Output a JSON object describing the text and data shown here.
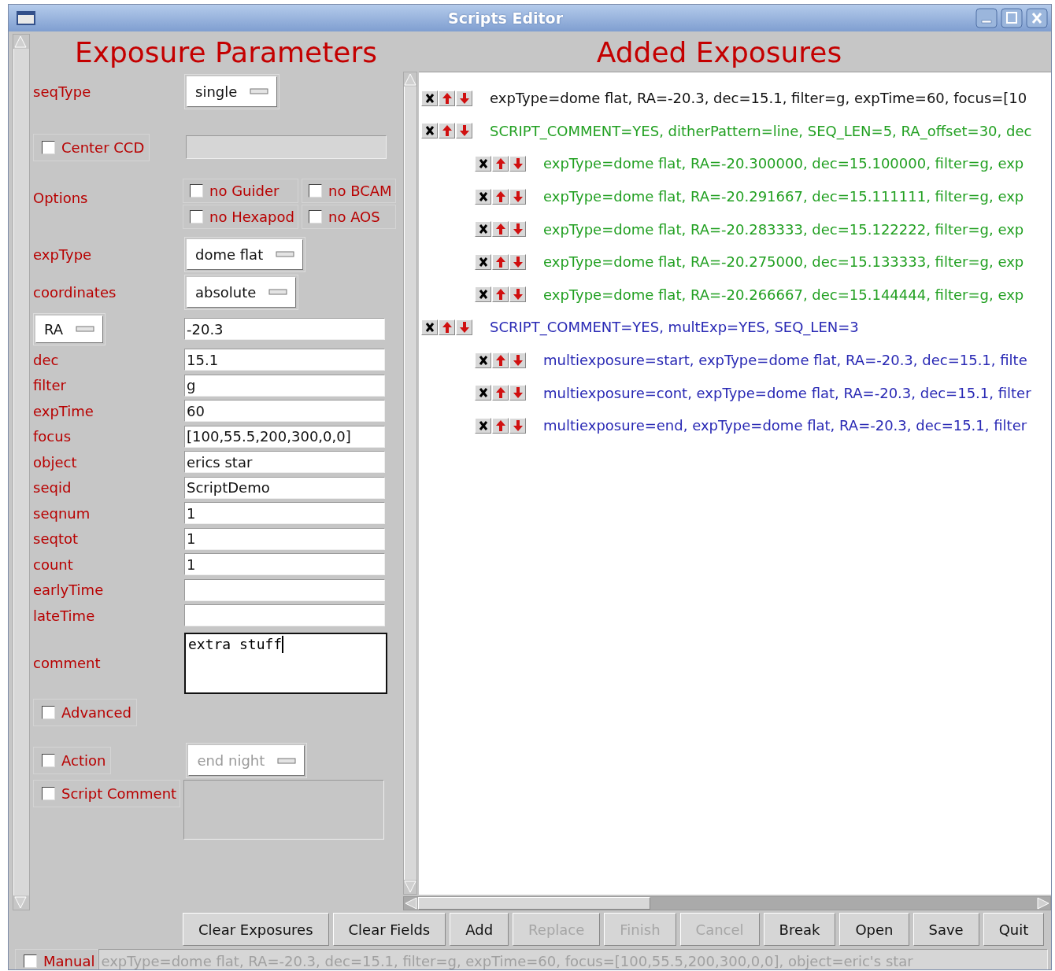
{
  "window": {
    "title": "Scripts Editor"
  },
  "parameters": {
    "title": "Exposure Parameters",
    "rows": [
      {
        "kind": "dropdown",
        "label": "seqType",
        "value": "single"
      },
      {
        "kind": "check_field",
        "label": "Center CCD",
        "checked": false
      },
      {
        "kind": "options",
        "label": "Options",
        "options": [
          {
            "label": "no Guider",
            "checked": false
          },
          {
            "label": "no BCAM",
            "checked": false
          },
          {
            "label": "no Hexapod",
            "checked": false
          },
          {
            "label": "no AOS",
            "checked": false
          }
        ]
      },
      {
        "kind": "dropdown",
        "label": "expType",
        "value": "dome flat"
      },
      {
        "kind": "dropdown",
        "label": "coordinates",
        "value": "absolute"
      },
      {
        "kind": "select_field",
        "selector": "RA",
        "value": "-20.3"
      },
      {
        "kind": "text",
        "label": "dec",
        "value": "15.1"
      },
      {
        "kind": "text",
        "label": "filter",
        "value": "g"
      },
      {
        "kind": "text",
        "label": "expTime",
        "value": "60"
      },
      {
        "kind": "text",
        "label": "focus",
        "value": "[100,55.5,200,300,0,0]"
      },
      {
        "kind": "text",
        "label": "object",
        "value": "erics star"
      },
      {
        "kind": "text",
        "label": "seqid",
        "value": "ScriptDemo"
      },
      {
        "kind": "text",
        "label": "seqnum",
        "value": "1"
      },
      {
        "kind": "text",
        "label": "seqtot",
        "value": "1"
      },
      {
        "kind": "text",
        "label": "count",
        "value": "1"
      },
      {
        "kind": "text",
        "label": "earlyTime"
      },
      {
        "kind": "text",
        "label": "lateTime"
      },
      {
        "kind": "textarea",
        "label": "comment",
        "value": "extra stuff"
      },
      {
        "kind": "check",
        "label": "Advanced",
        "checked": false
      },
      {
        "kind": "check_dropdown",
        "label": "Action",
        "checked": false,
        "value": "end night",
        "disabled": true
      },
      {
        "kind": "check_area",
        "label": "Script Comment",
        "checked": false
      }
    ]
  },
  "exposures": {
    "title": "Added Exposures",
    "items": [
      {
        "text": "expType=dome flat, RA=-20.3, dec=15.1, filter=g, expTime=60, focus=[10",
        "color": "#111111"
      },
      {
        "text": "SCRIPT_COMMENT=YES, ditherPattern=line, SEQ_LEN=5, RA_offset=30, dec",
        "color": "#22a022",
        "children": [
          {
            "text": "expType=dome flat, RA=-20.300000, dec=15.100000, filter=g, exp",
            "color": "#22a022"
          },
          {
            "text": "expType=dome flat, RA=-20.291667, dec=15.111111, filter=g, exp",
            "color": "#22a022"
          },
          {
            "text": "expType=dome flat, RA=-20.283333, dec=15.122222, filter=g, exp",
            "color": "#22a022"
          },
          {
            "text": "expType=dome flat, RA=-20.275000, dec=15.133333, filter=g, exp",
            "color": "#22a022"
          },
          {
            "text": "expType=dome flat, RA=-20.266667, dec=15.144444, filter=g, exp",
            "color": "#22a022"
          }
        ]
      },
      {
        "text": "SCRIPT_COMMENT=YES, multExp=YES, SEQ_LEN=3",
        "color": "#2828b4",
        "children": [
          {
            "text": "multiexposure=start, expType=dome flat, RA=-20.3, dec=15.1, filte",
            "color": "#2828b4"
          },
          {
            "text": "multiexposure=cont, expType=dome flat, RA=-20.3, dec=15.1, filter",
            "color": "#2828b4"
          },
          {
            "text": "multiexposure=end, expType=dome flat, RA=-20.3, dec=15.1, filter",
            "color": "#2828b4"
          }
        ]
      }
    ]
  },
  "buttons": [
    {
      "label": "Clear Exposures",
      "disabled": false
    },
    {
      "label": "Clear Fields",
      "disabled": false
    },
    {
      "label": "Add",
      "disabled": false
    },
    {
      "label": "Replace",
      "disabled": true
    },
    {
      "label": "Finish",
      "disabled": true
    },
    {
      "label": "Cancel",
      "disabled": true
    },
    {
      "label": "Break",
      "disabled": false
    },
    {
      "label": "Open",
      "disabled": false
    },
    {
      "label": "Save",
      "disabled": false
    },
    {
      "label": "Quit",
      "disabled": false
    }
  ],
  "manual": {
    "label": "Manual",
    "checked": false,
    "value": "expType=dome flat, RA=-20.3, dec=15.1, filter=g, expTime=60, focus=[100,55.5,200,300,0,0], object=eric's star"
  }
}
